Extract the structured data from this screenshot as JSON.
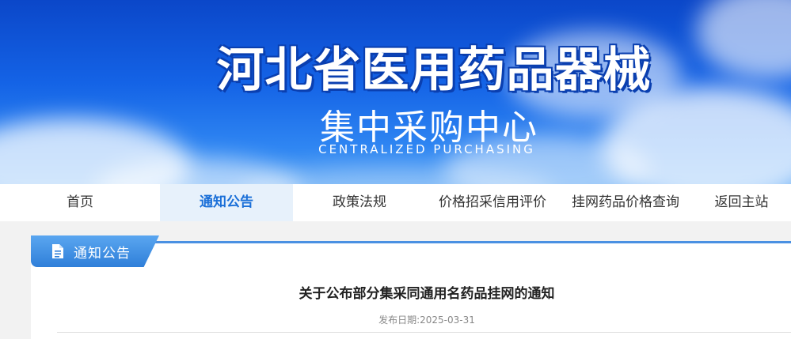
{
  "banner": {
    "title": "河北省医用药品器械",
    "subtitle": "集中采购中心",
    "subtitle_en": "CENTRALIZED PURCHASING"
  },
  "nav": {
    "items": [
      {
        "label": "首页"
      },
      {
        "label": "通知公告"
      },
      {
        "label": "政策法规"
      },
      {
        "label": "价格招采信用评价"
      },
      {
        "label": "挂网药品价格查询"
      },
      {
        "label": "返回主站"
      }
    ],
    "active_index": 1
  },
  "section": {
    "tab_label": "通知公告",
    "icon": "document-icon"
  },
  "article": {
    "title": "关于公布部分集采同通用名药品挂网的通知",
    "date": "发布日期:2025-03-31"
  },
  "colors": {
    "accent": "#1a6fd8",
    "tab_blue": "#2f7fd9",
    "nav_active_bg": "#e7f1fb"
  }
}
